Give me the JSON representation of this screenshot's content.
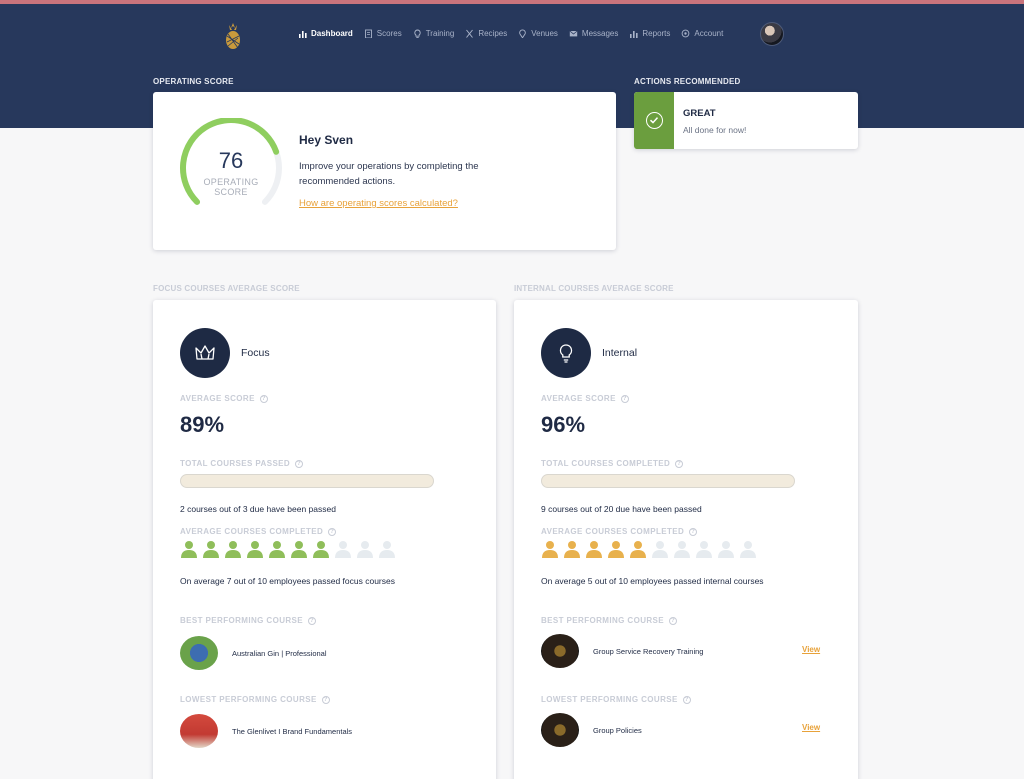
{
  "nav": {
    "items": [
      {
        "label": "Dashboard",
        "icon": "bar-chart-icon",
        "active": true
      },
      {
        "label": "Scores",
        "icon": "scores-icon",
        "active": false
      },
      {
        "label": "Training",
        "icon": "lightbulb-icon",
        "active": false
      },
      {
        "label": "Recipes",
        "icon": "utensils-icon",
        "active": false
      },
      {
        "label": "Venues",
        "icon": "map-pin-icon",
        "active": false
      },
      {
        "label": "Messages",
        "icon": "envelope-icon",
        "active": false
      },
      {
        "label": "Reports",
        "icon": "bar-chart-icon",
        "active": false
      },
      {
        "label": "Account",
        "icon": "gear-icon",
        "active": false
      }
    ]
  },
  "operating": {
    "section_label": "OPERATING SCORE",
    "score": "76",
    "score_fraction": 0.76,
    "score_caption_1": "OPERATING",
    "score_caption_2": "SCORE",
    "greeting": "Hey Sven",
    "message": "Improve your operations by completing the recommended actions.",
    "link": "How are operating scores calculated?"
  },
  "actions": {
    "section_label": "ACTIONS RECOMMENDED",
    "title": "GREAT",
    "subtitle": "All done for now!"
  },
  "focus": {
    "section_label": "FOCUS COURSES AVERAGE SCORE",
    "name": "Focus",
    "avg_label": "AVERAGE SCORE",
    "avg_value": "89%",
    "passed_label": "TOTAL COURSES PASSED",
    "progress_fraction": 0.0,
    "passed_text": "2 courses out of 3 due have been passed",
    "completed_label": "AVERAGE COURSES COMPLETED",
    "people_filled": 7,
    "people_total": 10,
    "people_color": "#8fbe5a",
    "people_text": "On average 7 out of 10 employees passed focus courses",
    "best_label": "BEST PERFORMING COURSE",
    "best_course": "Australian Gin | Professional",
    "lowest_label": "LOWEST PERFORMING COURSE",
    "lowest_course": "The Glenlivet I Brand Fundamentals"
  },
  "internal": {
    "section_label": "INTERNAL COURSES AVERAGE SCORE",
    "name": "Internal",
    "avg_label": "AVERAGE SCORE",
    "avg_value": "96%",
    "completed_total_label": "TOTAL COURSES COMPLETED",
    "progress_fraction": 0.0,
    "completed_text": "9 courses out of 20 due have been passed",
    "completed_label": "AVERAGE COURSES COMPLETED",
    "people_filled": 5,
    "people_total": 10,
    "people_color": "#e8b14d",
    "people_text": "On average 5 out of 10 employees passed internal courses",
    "best_label": "BEST PERFORMING COURSE",
    "best_course": "Group Service Recovery Training",
    "best_view": "View",
    "lowest_label": "LOWEST PERFORMING COURSE",
    "lowest_course": "Group Policies",
    "lowest_view": "View"
  },
  "colors": {
    "header": "#27385c",
    "accent": "#e8a23a",
    "success": "#6b9e3e",
    "gauge": "#8fce5f"
  }
}
